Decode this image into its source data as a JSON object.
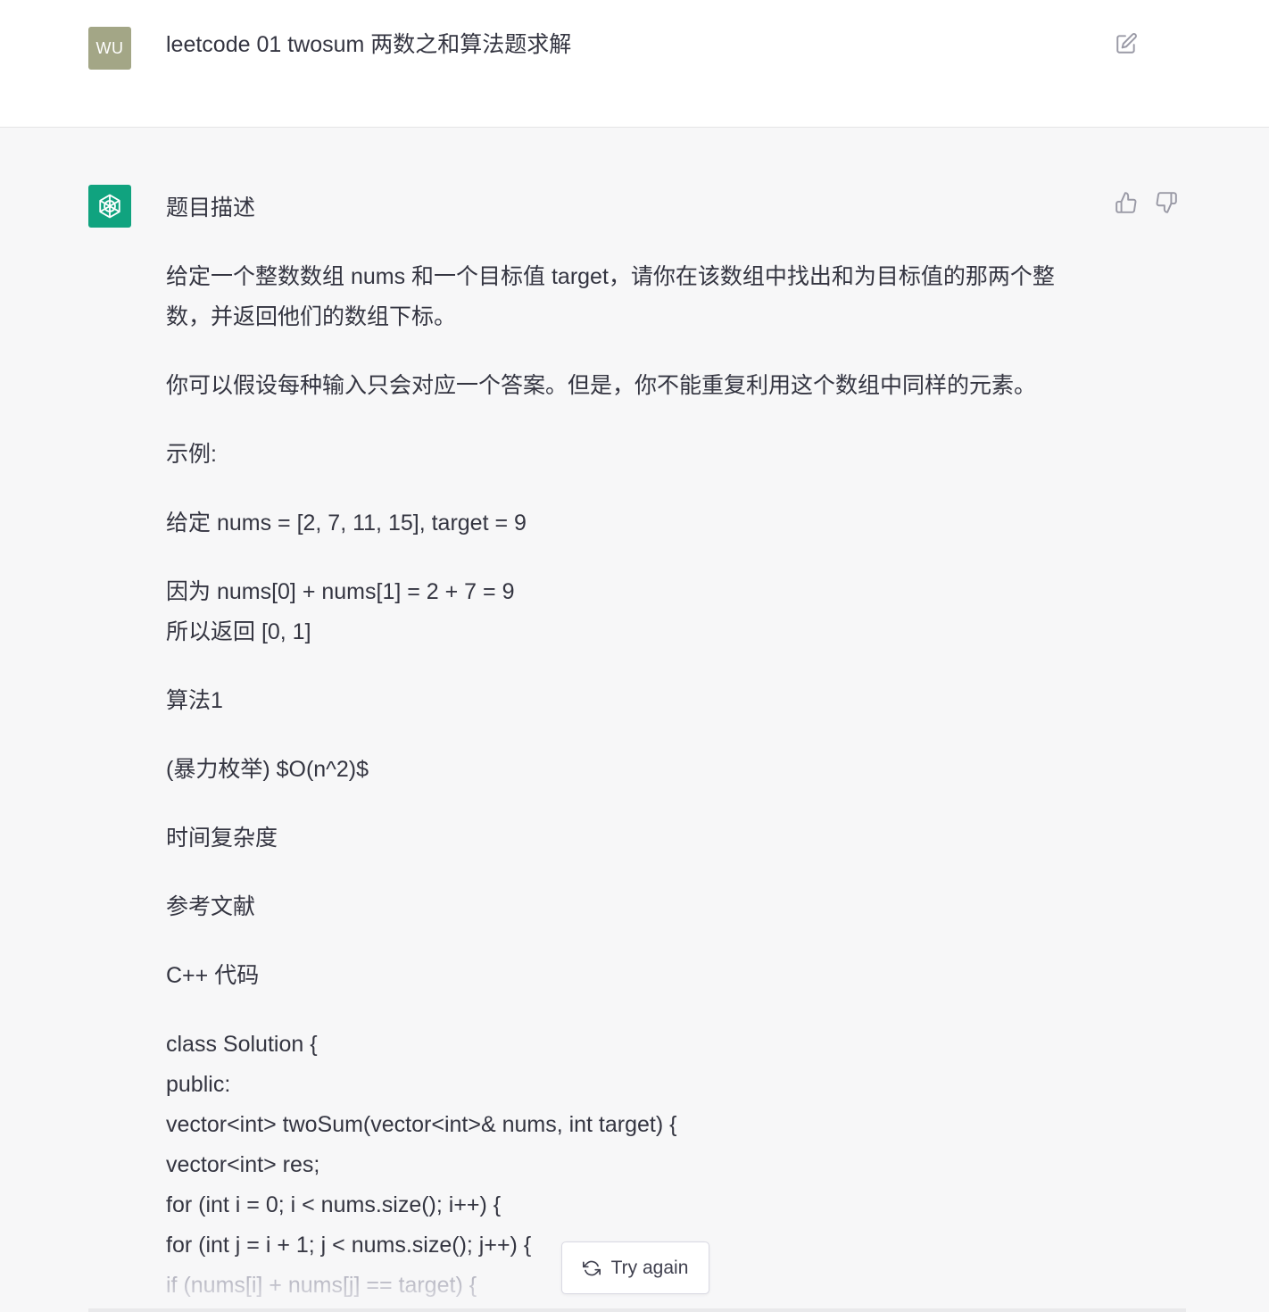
{
  "user": {
    "avatar_initials": "WU",
    "message": "leetcode 01 twosum 两数之和算法题求解",
    "edit_icon": "edit-icon"
  },
  "assistant": {
    "avatar_icon": "openai-logo-icon",
    "feedback": {
      "thumbs_up_icon": "thumbs-up-icon",
      "thumbs_down_icon": "thumbs-down-icon"
    },
    "paragraphs": [
      "题目描述",
      "给定一个整数数组 nums 和一个目标值 target，请你在该数组中找出和为目标值的那两个整数，并返回他们的数组下标。",
      "你可以假设每种输入只会对应一个答案。但是，你不能重复利用这个数组中同样的元素。",
      "示例:",
      "给定 nums = [2, 7, 11, 15], target = 9"
    ],
    "example_lines": [
      "因为 nums[0] + nums[1] = 2 + 7 = 9",
      "所以返回 [0, 1]"
    ],
    "paragraphs2": [
      "算法1",
      "(暴力枚举) $O(n^2)$",
      "时间复杂度",
      "参考文献",
      "C++ 代码"
    ],
    "code_lines": [
      "class Solution {",
      "public:",
      "vector<int> twoSum(vector<int>& nums, int target) {",
      "vector<int> res;",
      "for (int i = 0; i < nums.size(); i++) {",
      "for (int j = i + 1; j < nums.size(); j++) {",
      "if (nums[i] + nums[j] == target) {"
    ]
  },
  "try_again": {
    "label": "Try again",
    "icon": "refresh-icon"
  },
  "colors": {
    "user_avatar": "#a3a686",
    "assistant_avatar": "#10a37f",
    "background": "#f7f7f8"
  }
}
